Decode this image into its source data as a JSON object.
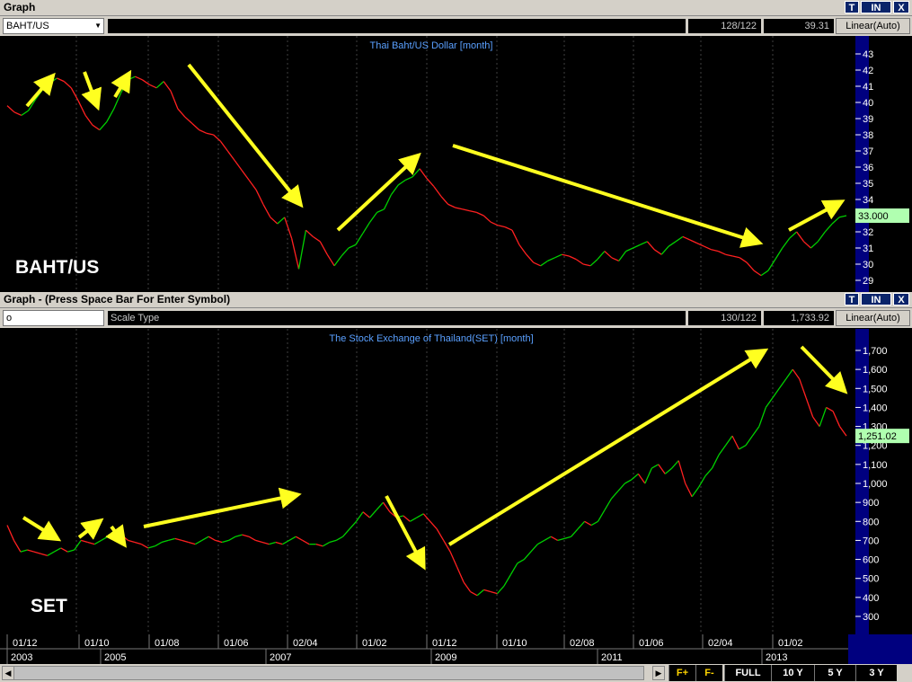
{
  "top_panel": {
    "window_title": "Graph",
    "btn_t": "T",
    "btn_in": "IN",
    "btn_x": "X",
    "symbol": "BAHT/US",
    "scale_type": "",
    "count": "128/122",
    "value": "39.31",
    "scale_mode": "Linear(Auto)",
    "chart_title": "Thai Baht/US Dollar [month]",
    "overlay_label": "BAHT/US",
    "last_value_tag": "33.000"
  },
  "bottom_panel": {
    "window_title": "Graph  - (Press Space Bar For Enter Symbol)",
    "btn_t": "T",
    "btn_in": "IN",
    "btn_x": "X",
    "symbol": "o",
    "scale_type": "Scale Type",
    "count": "130/122",
    "value": "1,733.92",
    "scale_mode": "Linear(Auto)",
    "chart_title": "The Stock Exchange of Thailand(SET) [month]",
    "overlay_label": "SET",
    "last_value_tag": "1,251.02"
  },
  "time_axis": {
    "month_labels": [
      "01/12",
      "01/10",
      "01/08",
      "01/06",
      "02/04",
      "01/02",
      "01/12",
      "01/10",
      "02/08",
      "01/06",
      "02/04",
      "01/02"
    ],
    "year_labels": [
      "2003",
      "2005",
      "2007",
      "2009",
      "2011",
      "2013"
    ]
  },
  "footer": {
    "fplus": "F+",
    "fminus": "F-",
    "timeframes": [
      "FULL",
      "10 Y",
      "5 Y",
      "3 Y"
    ]
  },
  "colors": {
    "up": "#00d000",
    "down": "#ff2020",
    "arrow": "#ffff20",
    "grid": "#404040",
    "axis_panel": "#00007f",
    "tag_bg": "#b0ffb0"
  },
  "chart_data": [
    {
      "type": "line",
      "title": "Thai Baht/US Dollar [month]",
      "xlabel": "",
      "ylabel": "",
      "x_range": [
        "2003-01",
        "2013-08"
      ],
      "ylim": [
        29,
        43
      ],
      "yticks": [
        29,
        30,
        31,
        32,
        33,
        34,
        35,
        36,
        37,
        38,
        39,
        40,
        41,
        42,
        43
      ],
      "grid": true,
      "series": [
        {
          "name": "BAHT/US",
          "values": [
            39.8,
            39.4,
            39.2,
            39.5,
            40.2,
            40.8,
            41.2,
            41.5,
            41.3,
            40.9,
            40.1,
            39.2,
            38.6,
            38.3,
            38.8,
            39.6,
            40.6,
            41.4,
            41.6,
            41.4,
            41.1,
            40.9,
            41.3,
            40.7,
            39.6,
            39.1,
            38.7,
            38.3,
            38.1,
            38.0,
            37.6,
            37.0,
            36.4,
            35.8,
            35.2,
            34.6,
            33.7,
            32.9,
            32.5,
            32.9,
            31.6,
            29.7,
            32.1,
            31.7,
            31.4,
            30.6,
            29.9,
            30.5,
            31.0,
            31.2,
            31.9,
            32.6,
            33.2,
            33.4,
            34.3,
            34.9,
            35.2,
            35.4,
            35.9,
            35.3,
            34.8,
            34.2,
            33.7,
            33.5,
            33.4,
            33.3,
            33.2,
            33.0,
            32.6,
            32.4,
            32.3,
            32.1,
            31.2,
            30.6,
            30.1,
            29.9,
            30.2,
            30.4,
            30.6,
            30.5,
            30.3,
            30.0,
            29.9,
            30.3,
            30.8,
            30.4,
            30.2,
            30.8,
            31.0,
            31.2,
            31.4,
            30.9,
            30.6,
            31.1,
            31.4,
            31.7,
            31.5,
            31.3,
            31.1,
            30.9,
            30.8,
            30.6,
            30.5,
            30.4,
            30.1,
            29.6,
            29.3,
            29.6,
            30.3,
            31.0,
            31.6,
            32.0,
            31.4,
            31.0,
            31.4,
            32.0,
            32.5,
            32.9,
            33.0
          ]
        }
      ]
    },
    {
      "type": "line",
      "title": "The Stock Exchange of Thailand(SET) [month]",
      "xlabel": "",
      "ylabel": "",
      "x_range": [
        "2003-01",
        "2013-08"
      ],
      "ylim": [
        300,
        1700
      ],
      "yticks": [
        300,
        400,
        500,
        600,
        700,
        800,
        900,
        1000,
        1100,
        1200,
        1300,
        1400,
        1500,
        1600,
        1700
      ],
      "grid": true,
      "series": [
        {
          "name": "SET",
          "values": [
            780,
            700,
            640,
            650,
            640,
            630,
            620,
            640,
            660,
            640,
            650,
            700,
            690,
            680,
            700,
            720,
            740,
            730,
            700,
            690,
            680,
            660,
            670,
            690,
            700,
            710,
            700,
            690,
            680,
            700,
            720,
            700,
            690,
            700,
            720,
            730,
            720,
            700,
            690,
            680,
            690,
            680,
            700,
            720,
            700,
            680,
            680,
            670,
            690,
            700,
            720,
            760,
            800,
            850,
            820,
            860,
            900,
            850,
            820,
            830,
            800,
            820,
            840,
            800,
            760,
            700,
            640,
            560,
            480,
            430,
            410,
            440,
            430,
            420,
            460,
            520,
            580,
            600,
            640,
            680,
            700,
            720,
            700,
            710,
            720,
            760,
            800,
            780,
            800,
            860,
            920,
            960,
            1000,
            1020,
            1050,
            1000,
            1080,
            1100,
            1050,
            1080,
            1120,
            1000,
            930,
            980,
            1040,
            1080,
            1150,
            1200,
            1250,
            1180,
            1200,
            1250,
            1300,
            1400,
            1450,
            1500,
            1550,
            1600,
            1550,
            1450,
            1350,
            1300,
            1400,
            1380,
            1300,
            1250
          ]
        }
      ]
    }
  ]
}
